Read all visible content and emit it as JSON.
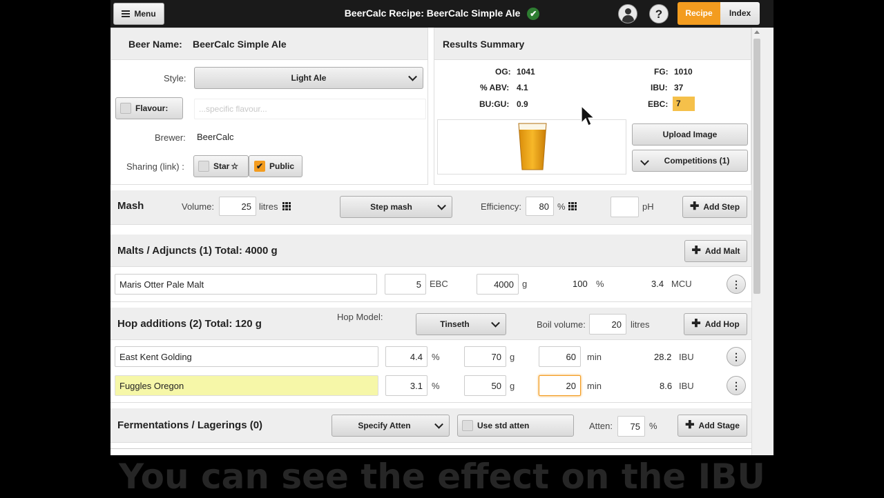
{
  "topbar": {
    "menu_label": "Menu",
    "title": "BeerCalc Recipe: BeerCalc Simple Ale",
    "recipe_tab": "Recipe",
    "index_tab": "Index"
  },
  "recipe": {
    "beer_name_label": "Beer Name:",
    "beer_name": "BeerCalc Simple Ale",
    "style_label": "Style:",
    "style_value": "Light Ale",
    "flavour_label": "Flavour:",
    "flavour_placeholder": "...specific flavour...",
    "brewer_label": "Brewer:",
    "brewer_value": "BeerCalc",
    "sharing_label": "Sharing (link) :",
    "star_label": "Star",
    "public_label": "Public"
  },
  "results": {
    "title": "Results Summary",
    "og_label": "OG:",
    "og": "1041",
    "abv_label": "% ABV:",
    "abv": "4.1",
    "bugu_label": "BU:GU:",
    "bugu": "0.9",
    "fg_label": "FG:",
    "fg": "1010",
    "ibu_label": "IBU:",
    "ibu": "37",
    "ebc_label": "EBC:",
    "ebc": "7",
    "ebc_color": "#f5c04a",
    "upload_label": "Upload Image",
    "competitions_label": "Competitions (1)"
  },
  "mash": {
    "title": "Mash",
    "volume_label": "Volume:",
    "volume": "25",
    "volume_unit": "litres",
    "type": "Step mash",
    "efficiency_label": "Efficiency:",
    "efficiency": "80",
    "efficiency_unit": "%",
    "ph_value": "",
    "ph_label": "pH",
    "add_label": "Add Step"
  },
  "malts": {
    "title": "Malts / Adjuncts (1) Total: 4000 g",
    "add_label": "Add Malt",
    "rows": [
      {
        "name": "Maris Otter Pale Malt",
        "ebc": "5",
        "ebc_unit": "EBC",
        "weight": "4000",
        "weight_unit": "g",
        "percent": "100",
        "percent_unit": "%",
        "mcu": "3.4",
        "mcu_unit": "MCU"
      }
    ]
  },
  "hops": {
    "title": "Hop additions (2) Total: 120 g",
    "model_label": "Hop Model:",
    "model": "Tinseth",
    "boil_label": "Boil volume:",
    "boil_volume": "20",
    "boil_unit": "litres",
    "add_label": "Add Hop",
    "rows": [
      {
        "name": "East Kent Golding",
        "alpha": "4.4",
        "alpha_unit": "%",
        "weight": "70",
        "weight_unit": "g",
        "time": "60",
        "time_unit": "min",
        "ibu": "28.2",
        "ibu_unit": "IBU"
      },
      {
        "name": "Fuggles Oregon",
        "alpha": "3.1",
        "alpha_unit": "%",
        "weight": "50",
        "weight_unit": "g",
        "time": "20",
        "time_unit": "min",
        "ibu": "8.6",
        "ibu_unit": "IBU"
      }
    ]
  },
  "fermentation": {
    "title": "Fermentations / Lagerings (0)",
    "mode": "Specify Atten",
    "std_atten_label": "Use std atten",
    "atten_label": "Atten:",
    "atten": "75",
    "atten_unit": "%",
    "add_label": "Add Stage"
  },
  "caption": "You can see the effect on the IBU",
  "colors": {
    "accent": "#f39c1f",
    "highlight_row": "#f6f7a8",
    "success": "#4caf50"
  }
}
